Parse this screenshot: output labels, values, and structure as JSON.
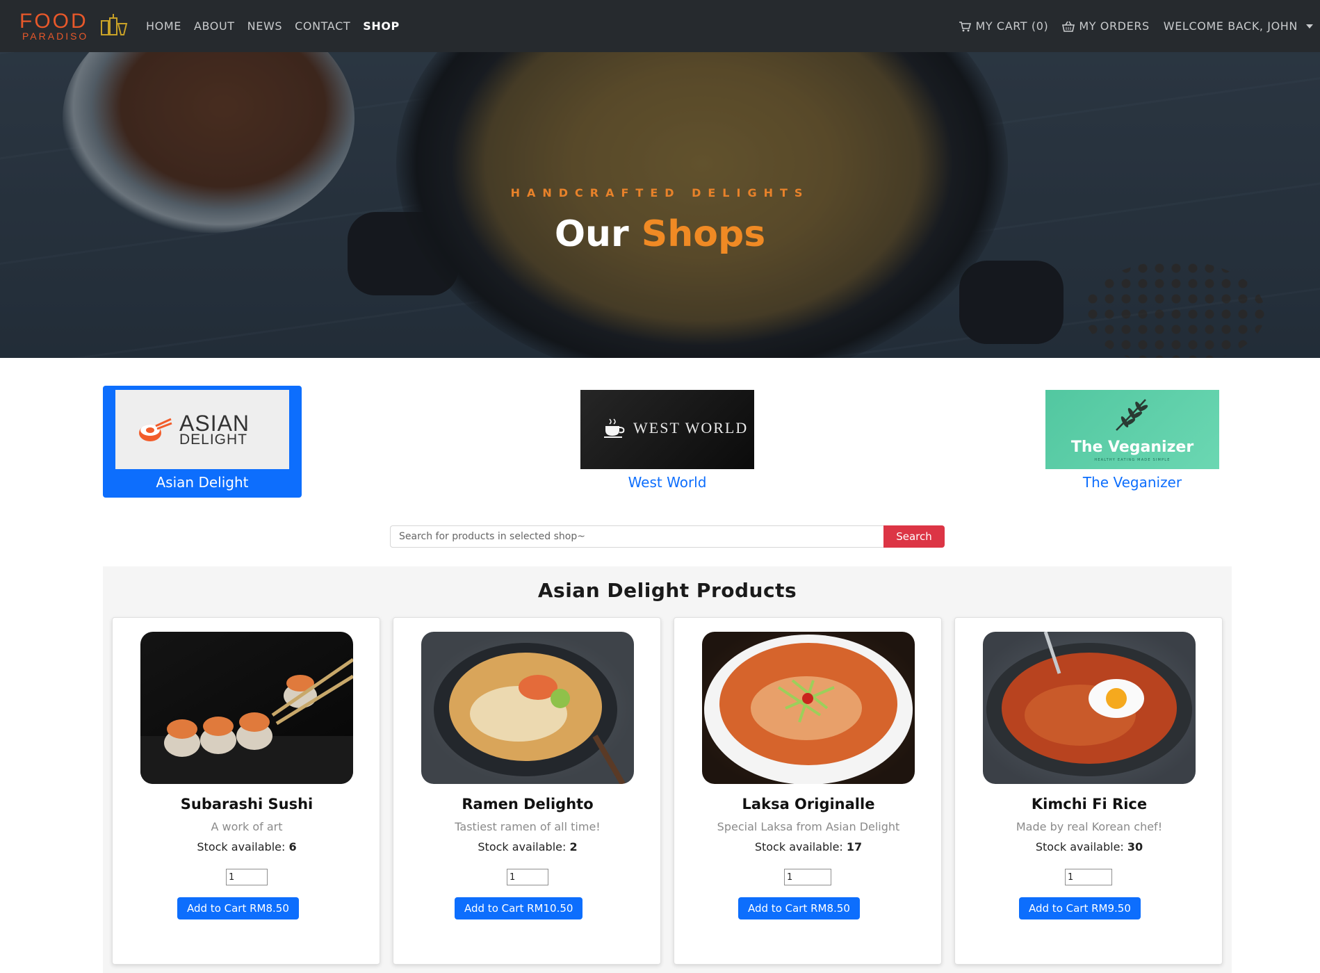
{
  "brand": {
    "logo_top": "FOOD",
    "logo_bottom": "PARADISO"
  },
  "nav": {
    "links": [
      "HOME",
      "ABOUT",
      "NEWS",
      "CONTACT",
      "SHOP"
    ],
    "active": "SHOP",
    "cart_label": "MY CART (0)",
    "orders_label": "MY ORDERS",
    "user_label": "WELCOME BACK, JOHN"
  },
  "hero": {
    "subtitle": "HANDCRAFTED DELIGHTS",
    "title_white": "Our",
    "title_accent": "Shops"
  },
  "shops": [
    {
      "name": "Asian Delight",
      "logo_line1": "ASIAN",
      "logo_line2": "DELIGHT",
      "selected": true
    },
    {
      "name": "West World",
      "logo_text": "WEST WORLD",
      "selected": false
    },
    {
      "name": "The Veganizer",
      "logo_text": "The Veganizer",
      "logo_tagline": "HEALTHY EATING MADE SIMPLE",
      "selected": false
    }
  ],
  "search": {
    "placeholder": "Search for products in selected shop~",
    "button_label": "Search"
  },
  "products_section": {
    "title": "Asian Delight Products"
  },
  "products": [
    {
      "name": "Subarashi Sushi",
      "description": "A work of art",
      "stock_label": "Stock available:",
      "stock": "6",
      "qty": "1",
      "button_label": "Add to Cart RM8.50"
    },
    {
      "name": "Ramen Delighto",
      "description": "Tastiest ramen of all time!",
      "stock_label": "Stock available:",
      "stock": "2",
      "qty": "1",
      "button_label": "Add to Cart RM10.50"
    },
    {
      "name": "Laksa Originalle",
      "description": "Special Laksa from Asian Delight",
      "stock_label": "Stock available:",
      "stock": "17",
      "qty": "1",
      "button_label": "Add to Cart RM8.50"
    },
    {
      "name": "Kimchi Fi Rice",
      "description": "Made by real Korean chef!",
      "stock_label": "Stock available:",
      "stock": "30",
      "qty": "1",
      "button_label": "Add to Cart RM9.50"
    }
  ],
  "icons": {
    "cart": "cart-icon",
    "orders": "basket-icon",
    "dropdown": "chevron-down-icon"
  },
  "colors": {
    "accent_orange": "#f08a24",
    "primary_blue": "#0d6efd",
    "danger_red": "#dc3545",
    "nav_bg": "#262a2e"
  }
}
